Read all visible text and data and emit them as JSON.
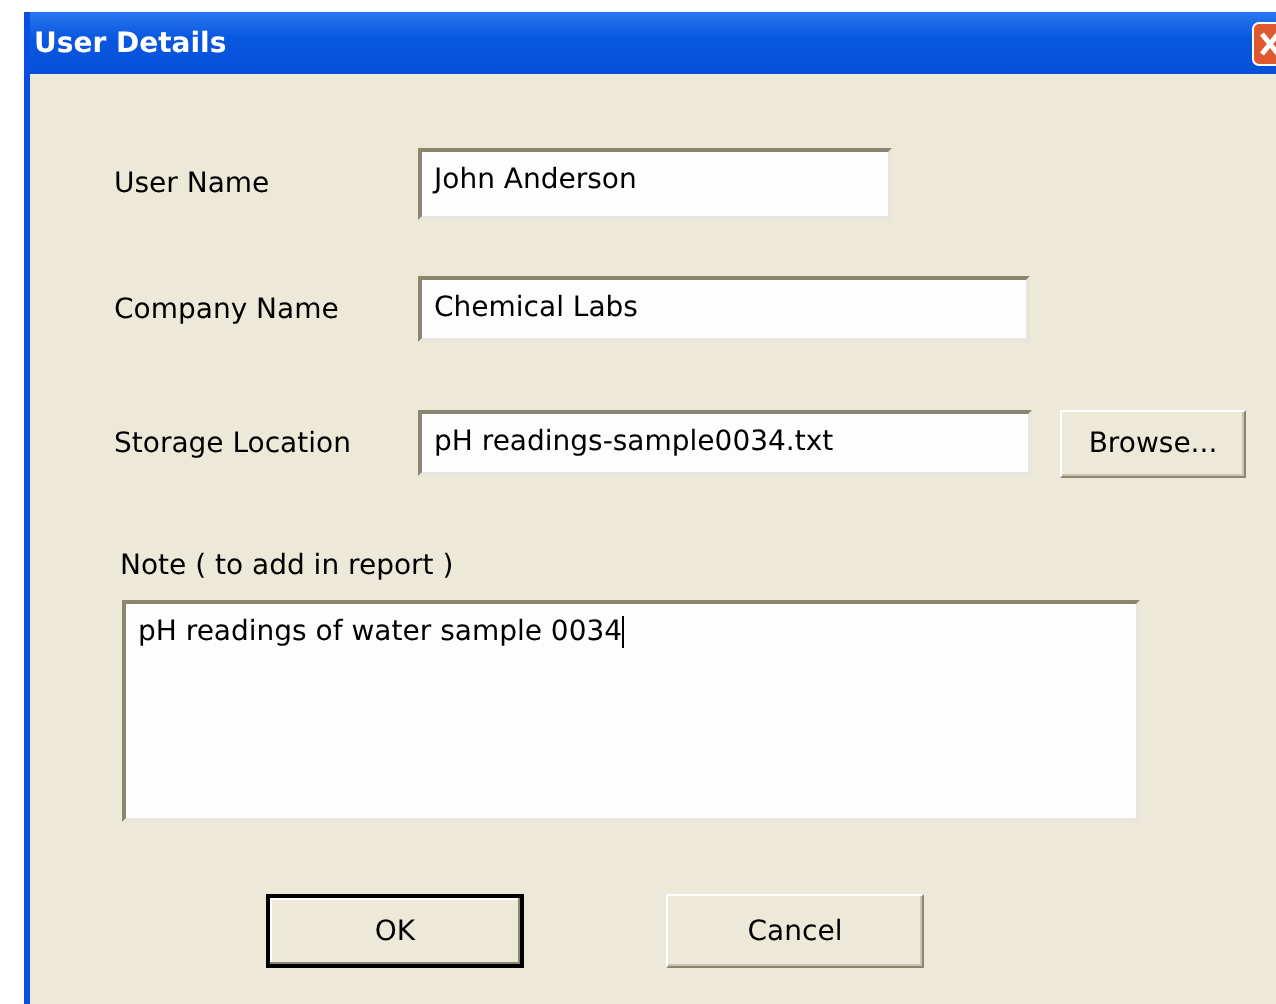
{
  "window": {
    "title": "User Details"
  },
  "fields": [
    {
      "label": "User Name",
      "value": "John Anderson"
    },
    {
      "label": "Company Name",
      "value": "Chemical Labs"
    },
    {
      "label": "Storage Location",
      "value": "pH readings-sample0034.txt",
      "button": "Browse..."
    }
  ],
  "note": {
    "label": "Note ( to add in report )",
    "value": "pH readings of water sample 0034",
    "focused": true
  },
  "buttons": [
    {
      "label": "OK",
      "default": true
    },
    {
      "label": "Cancel",
      "default": false
    }
  ]
}
